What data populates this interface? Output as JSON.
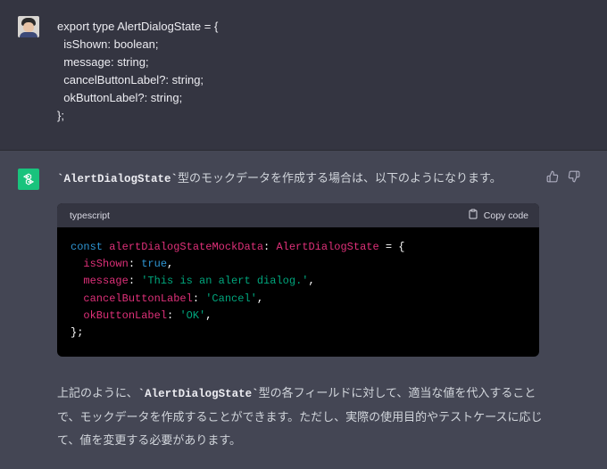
{
  "user_message": {
    "lines": [
      "export type AlertDialogState = {",
      "  isShown: boolean;",
      "  message: string;",
      "  cancelButtonLabel?: string;",
      "  okButtonLabel?: string;",
      "};"
    ]
  },
  "assistant": {
    "intro_code": "`AlertDialogState`",
    "intro_text": "型のモックデータを作成する場合は、以下のようになります。",
    "code_block": {
      "language": "typescript",
      "copy_label": "Copy code",
      "tokens": {
        "const": "const",
        "var_name": "alertDialogStateMockData",
        "colon": ":",
        "type_name": "AlertDialogState",
        "equals_brace": " = {",
        "isShown_key": "isShown",
        "isShown_val": "true",
        "message_key": "message",
        "message_val": "'This is an alert dialog.'",
        "cancel_key": "cancelButtonLabel",
        "cancel_val": "'Cancel'",
        "ok_key": "okButtonLabel",
        "ok_val": "'OK'",
        "close": "};"
      }
    },
    "outro_pre": "上記のように、",
    "outro_code": "`AlertDialogState`",
    "outro_post": "型の各フィールドに対して、適当な値を代入することで、モックデータを作成することができます。ただし、実際の使用目的やテストケースに応じて、値を変更する必要があります。"
  },
  "colors": {
    "assistant_bg": "#444654",
    "user_bg": "#343541",
    "accent": "#19c37d"
  }
}
